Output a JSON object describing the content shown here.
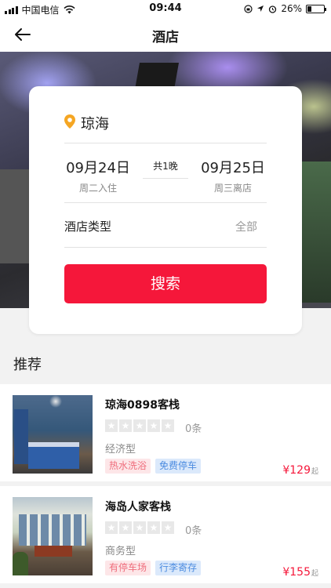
{
  "status_bar": {
    "carrier": "中国电信",
    "time": "09:44",
    "battery": "26%",
    "battery_level": 0.26
  },
  "nav": {
    "title": "酒店",
    "back_icon": "arrow-left-icon"
  },
  "search": {
    "city": "琼海",
    "pin_icon": "location-pin-icon",
    "pin_color": "#f5a623",
    "check_in_date": "09月24日",
    "check_in_sub": "周二入住",
    "nights": "共1晚",
    "check_out_date": "09月25日",
    "check_out_sub": "周三离店",
    "hotel_type_label": "酒店类型",
    "hotel_type_value": "全部",
    "button_label": "搜索",
    "button_color": "#f5173a"
  },
  "recommend": {
    "title": "推荐",
    "hotels": [
      {
        "name": "琼海0898客栈",
        "stars": 0,
        "reviews": "0条",
        "type": "经济型",
        "tags": [
          "热水洗浴",
          "免费停车"
        ],
        "price": "129",
        "currency": "¥",
        "price_suffix": "起"
      },
      {
        "name": "海岛人家客栈",
        "stars": 0,
        "reviews": "0条",
        "type": "商务型",
        "tags": [
          "有停车场",
          "行李寄存"
        ],
        "price": "155",
        "currency": "¥",
        "price_suffix": "起"
      }
    ]
  }
}
